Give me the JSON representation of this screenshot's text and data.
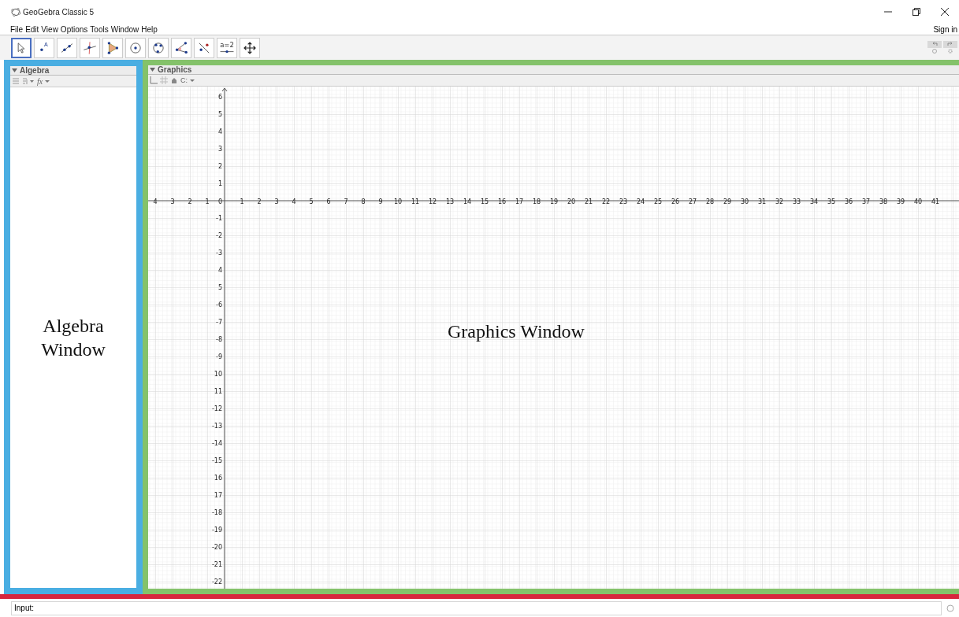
{
  "window": {
    "title": "GeoGebra Classic 5"
  },
  "menu": [
    "File",
    "Edit",
    "View",
    "Options",
    "Tools",
    "Window",
    "Help"
  ],
  "sign_in": "Sign in",
  "toolbar": {
    "tools": [
      {
        "kind": "move",
        "selected": true
      },
      {
        "kind": "point",
        "selected": false,
        "icon_text": "A"
      },
      {
        "kind": "line",
        "selected": false
      },
      {
        "kind": "perpendicular",
        "selected": false
      },
      {
        "kind": "polygon",
        "selected": false
      },
      {
        "kind": "circle",
        "selected": false
      },
      {
        "kind": "conic",
        "selected": false
      },
      {
        "kind": "angle",
        "selected": false
      },
      {
        "kind": "reflect",
        "selected": false
      },
      {
        "kind": "slider",
        "selected": false,
        "icon_text": "a=2"
      },
      {
        "kind": "move-view",
        "selected": false
      }
    ]
  },
  "algebra": {
    "title": "Algebra",
    "style_label": "fx",
    "annotation": "Algebra Window"
  },
  "graphics": {
    "title": "Graphics",
    "style_label": "C:",
    "annotation": "Graphics Window",
    "x_labels_negative": [
      "4",
      "3",
      "2",
      "1"
    ],
    "origin_label": "0",
    "x_labels_positive": [
      "1",
      "2",
      "3",
      "4",
      "5",
      "6",
      "7",
      "8",
      "9",
      "10",
      "11",
      "12",
      "13",
      "14",
      "15",
      "16",
      "17",
      "18",
      "19",
      "20",
      "21",
      "22",
      "23",
      "24",
      "25",
      "26",
      "27",
      "28",
      "29",
      "30",
      "31",
      "32",
      "33",
      "34",
      "35",
      "36",
      "37",
      "38",
      "39",
      "40",
      "41"
    ],
    "y_labels_positive": [
      "6",
      "5",
      "4",
      "3",
      "2",
      "1"
    ],
    "y_labels_negative": [
      "-1",
      "-2",
      "-3",
      "4",
      "5",
      "-6",
      "-7",
      "-8",
      "-9",
      "10",
      "11",
      "-12",
      "-13",
      "-14",
      "-15",
      "16",
      "17",
      "-18",
      "-19",
      "-20",
      "-21",
      "-22"
    ]
  },
  "input_bar": {
    "label": "Input:"
  }
}
